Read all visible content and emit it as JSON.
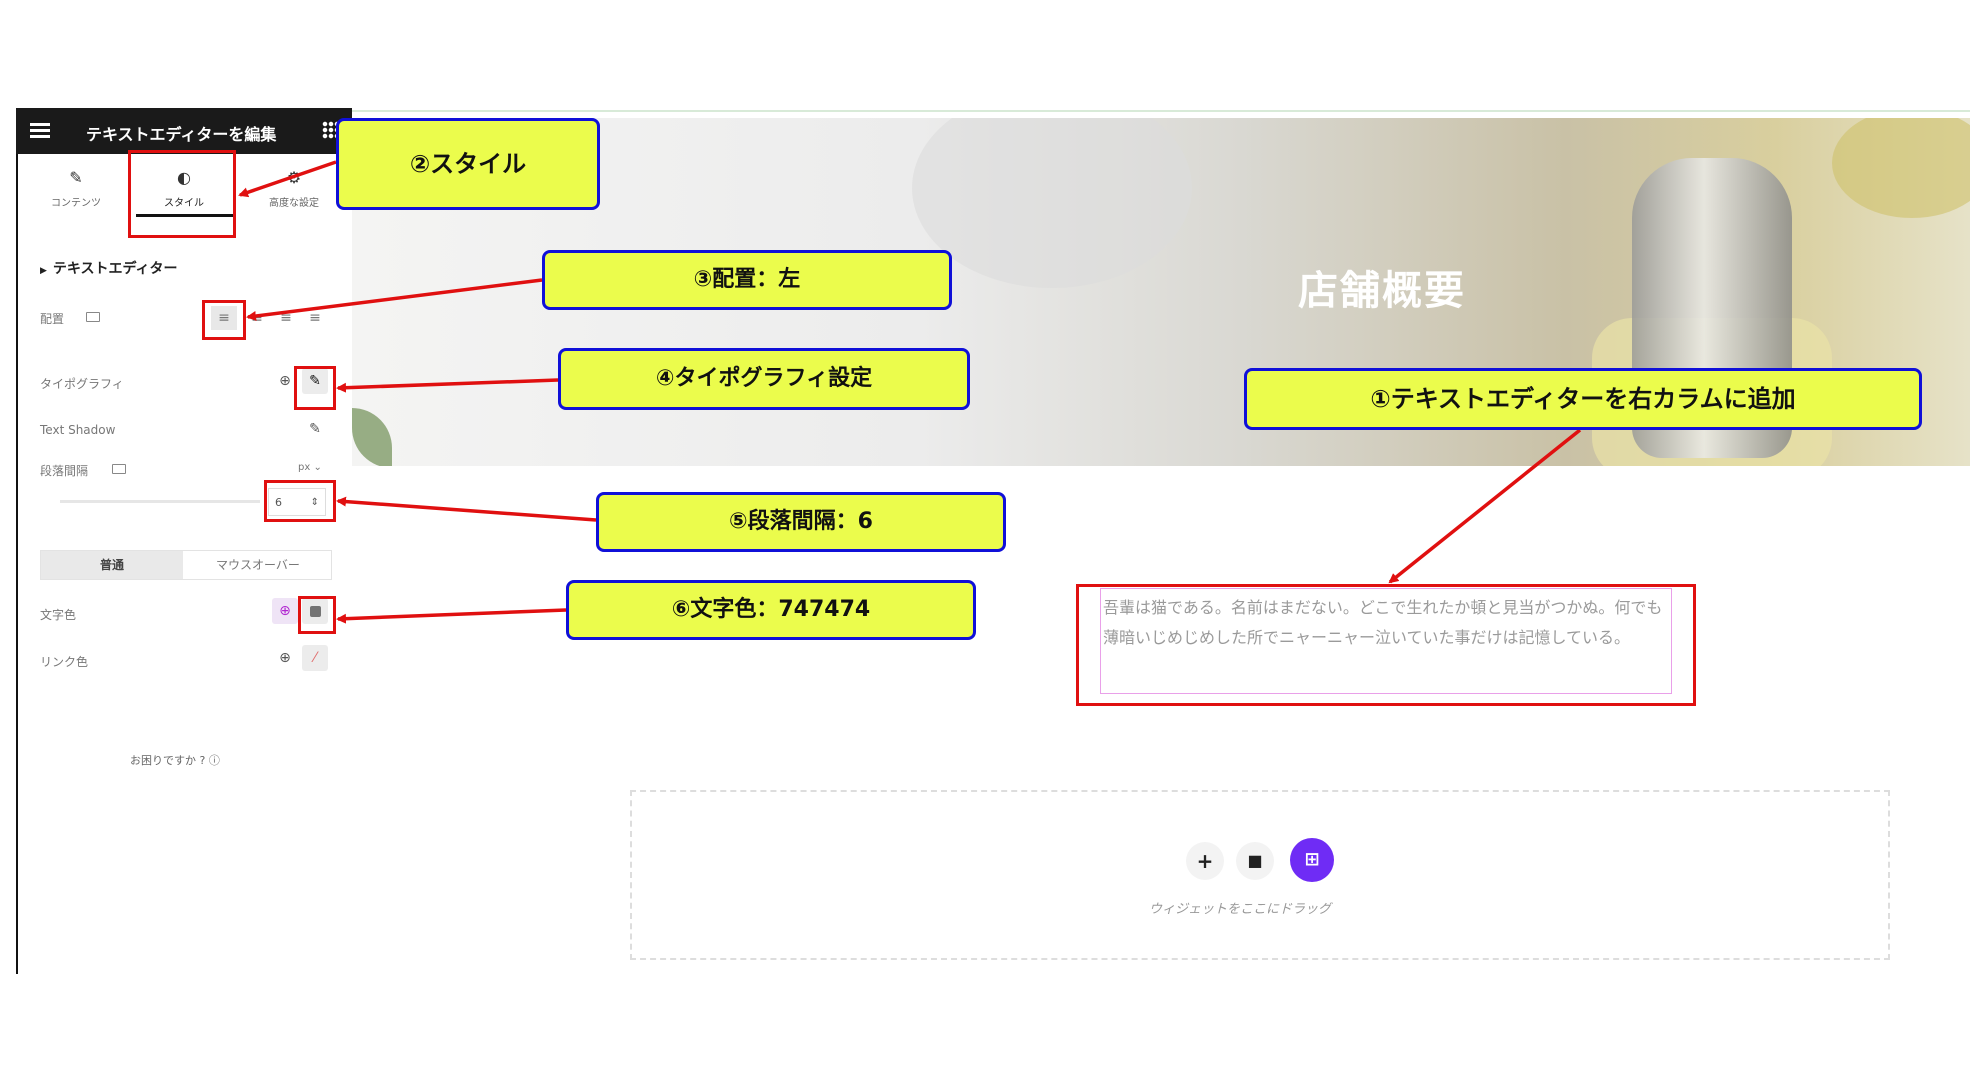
{
  "panel": {
    "title": "テキストエディターを編集",
    "tabs": [
      {
        "label": "コンテンツ",
        "icon": "pencil-icon"
      },
      {
        "label": "スタイル",
        "icon": "contrast-icon"
      },
      {
        "label": "高度な設定",
        "icon": "gear-icon"
      }
    ],
    "section_title": "テキストエディター",
    "alignment_label": "配置",
    "typography_label": "タイポグラフィ",
    "text_shadow_label": "Text Shadow",
    "paragraph_spacing_label": "段落間隔",
    "paragraph_spacing_unit": "px",
    "paragraph_spacing_value": "6",
    "state_tabs": [
      "普通",
      "マウスオーバー"
    ],
    "text_color_label": "文字色",
    "link_color_label": "リンク色",
    "help": "お困りですか ?",
    "text_color_hex": "#747474"
  },
  "canvas": {
    "hero_title": "店舗概要",
    "text_body": "吾輩は猫である。名前はまだない。どこで生れたか頓と見当がつかぬ。何でも薄暗いじめじめした所でニャーニャー泣いていた事だけは記憶している。",
    "drop_caption": "ウィジェットをここにドラッグ"
  },
  "callouts": {
    "c1": "①テキストエディターを右カラムに追加",
    "c2": "②スタイル",
    "c3": "③配置：左",
    "c4": "④タイポグラフィ設定",
    "c5": "⑤段落間隔：6",
    "c6": "⑥文字色：747474"
  },
  "colors": {
    "callout_fill": "#ebfc4c",
    "callout_border": "#1010d8",
    "arrow": "#e01010",
    "accent_purple": "#6f2cf5"
  }
}
